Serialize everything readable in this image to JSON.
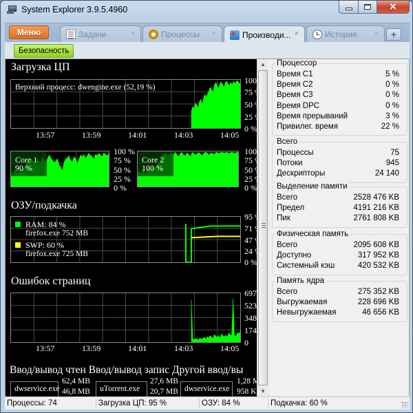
{
  "window": {
    "title": "System Explorer 3.9.5.4960",
    "controls": {
      "minimize": "minimize",
      "maximize": "maximize",
      "close": "close"
    }
  },
  "tabs": {
    "menu_label": "Меню",
    "items": [
      {
        "label": "Задачи",
        "icon": "tasks-icon",
        "active": false
      },
      {
        "label": "Процессы",
        "icon": "gear-icon",
        "active": false
      },
      {
        "label": "Производи...",
        "icon": "performance-icon",
        "active": true
      },
      {
        "label": "История",
        "icon": "clock-icon",
        "active": false
      }
    ],
    "close_glyph": "×",
    "add_tab_glyph": "+"
  },
  "toolbar": {
    "security_label": "Безопасность"
  },
  "cpu": {
    "title": "Загрузка ЦП",
    "top_process": "Верхний процесс: dwengine.exe (52,19 %)",
    "y_ticks": [
      "100 %",
      "75 %",
      "50 %",
      "25 %",
      "0 %"
    ],
    "x_ticks": [
      "13:57",
      "13:59",
      "14:01",
      "14:03",
      "14:05"
    ],
    "series_pct": [
      35,
      45,
      40,
      52,
      48,
      42,
      55,
      60,
      50,
      62,
      70,
      65,
      72,
      78,
      85,
      80,
      75,
      90,
      95,
      88,
      82,
      92,
      96,
      90,
      85,
      94,
      98,
      92,
      88,
      95,
      90,
      97,
      93,
      96,
      99,
      94,
      92
    ]
  },
  "cores": [
    {
      "label": "Core 1",
      "value": "90 %",
      "y_ticks": [
        "100 %",
        "75 %",
        "50 %",
        "25 %",
        "0 %"
      ],
      "series_pct": [
        40,
        35,
        45,
        42,
        38,
        45,
        50,
        48,
        55,
        62,
        72,
        68,
        80,
        75,
        70,
        65,
        78,
        72,
        68,
        85,
        75,
        70,
        80,
        90,
        82,
        75,
        68,
        72,
        80,
        62,
        55,
        45,
        70,
        78,
        82,
        88,
        75,
        70,
        85,
        80,
        65,
        78,
        90,
        85,
        92,
        80,
        88,
        95,
        90,
        85,
        78,
        92,
        88,
        95,
        90,
        85,
        96,
        92,
        88,
        94
      ]
    },
    {
      "label": "Core 2",
      "value": "100 %",
      "y_ticks": [
        "100",
        "75 %",
        "50 %",
        "25 %",
        "0 %"
      ],
      "series_pct": [
        40,
        45,
        35,
        50,
        42,
        38,
        55,
        48,
        45,
        60,
        52,
        58,
        65,
        75,
        85,
        90,
        95,
        92,
        88,
        96,
        94,
        90,
        98,
        92,
        85,
        95,
        98,
        90,
        88,
        96,
        92,
        85,
        98,
        94,
        90,
        95,
        97,
        92,
        88,
        96,
        98,
        95,
        90,
        97,
        94,
        92,
        98,
        96,
        94,
        99,
        97,
        95,
        98,
        96,
        94,
        99,
        97,
        95,
        98,
        97
      ]
    }
  ],
  "memory": {
    "title": "ОЗУ/подкачка",
    "ram_label": "RAM: 84 %",
    "ram_process": "firefox.exe 752 MB",
    "swp_label": "SWP: 60 %",
    "swp_process": "firefox.exe 725 MB",
    "y_ticks": [
      "95 %",
      "71 %",
      "47 %",
      "24 %",
      "0 %"
    ],
    "ram_color": "#00ff00",
    "swp_color": "#ffff00",
    "ram_pct": 84,
    "swp_pct": 60
  },
  "page_faults": {
    "title": "Ошибок страниц",
    "y_ticks": [
      "697",
      "523",
      "348",
      "174",
      "0"
    ],
    "x_ticks": [
      "13:57",
      "13:59",
      "14:01",
      "14:03",
      "14:05"
    ],
    "series": [
      600,
      40,
      35,
      50,
      45,
      30,
      60,
      40,
      55,
      70,
      45,
      80,
      60,
      90,
      75,
      50,
      110,
      85,
      70,
      95,
      60,
      120,
      90,
      80,
      100,
      75,
      130,
      110,
      90,
      620,
      100,
      80,
      140,
      120,
      150
    ]
  },
  "io": {
    "headers": [
      "Ввод/вывод чтен",
      "Ввод/вывод запис",
      "Другой ввод/вы"
    ],
    "boxes": [
      {
        "process": "dwservice.exe",
        "max": "62,4 MB",
        "mid": "46,8 MB"
      },
      {
        "process": "uTorrent.exe",
        "max": "27,6 MB",
        "mid": "20,7 MB"
      },
      {
        "process": "dwservice.exe",
        "max": "1,28 M",
        "mid": "958 K"
      }
    ]
  },
  "stats": {
    "groups": [
      {
        "title": "Процессор",
        "rows": [
          {
            "k": "Время C1",
            "v": "5 %"
          },
          {
            "k": "Время C2",
            "v": "0 %"
          },
          {
            "k": "Время C3",
            "v": "0 %"
          },
          {
            "k": "Время DPC",
            "v": "0 %"
          },
          {
            "k": "Время прерываний",
            "v": "3 %"
          },
          {
            "k": "Привилег. время",
            "v": "22 %"
          }
        ]
      },
      {
        "title": "Всего",
        "rows": [
          {
            "k": "Процессы",
            "v": "75"
          },
          {
            "k": "Потоки",
            "v": "945"
          },
          {
            "k": "Дескрипторы",
            "v": "24 140"
          }
        ]
      },
      {
        "title": "Выделение памяти",
        "rows": [
          {
            "k": "Всего",
            "v": "2528 476 KB"
          },
          {
            "k": "Предел",
            "v": "4191 216 KB"
          },
          {
            "k": "Пик",
            "v": "2761 808 KB"
          }
        ]
      },
      {
        "title": "Физическая память",
        "rows": [
          {
            "k": "Всего",
            "v": "2095 608 KB"
          },
          {
            "k": "Доступно",
            "v": "317 952 KB"
          },
          {
            "k": "Системный кэш",
            "v": "420 532 KB"
          }
        ]
      },
      {
        "title": "Память ядра",
        "rows": [
          {
            "k": "Всего",
            "v": "275 352 KB"
          },
          {
            "k": "Выгружаемая",
            "v": "228 696 KB"
          },
          {
            "k": "Невыгружаемая",
            "v": "46 656 KB"
          }
        ]
      }
    ]
  },
  "statusbar": {
    "processes": "Процессы: 74",
    "cpu": "Загрузка ЦП: 95 %",
    "ram": "ОЗУ: 84 %",
    "swap": "Подкачка: 60 %"
  }
}
